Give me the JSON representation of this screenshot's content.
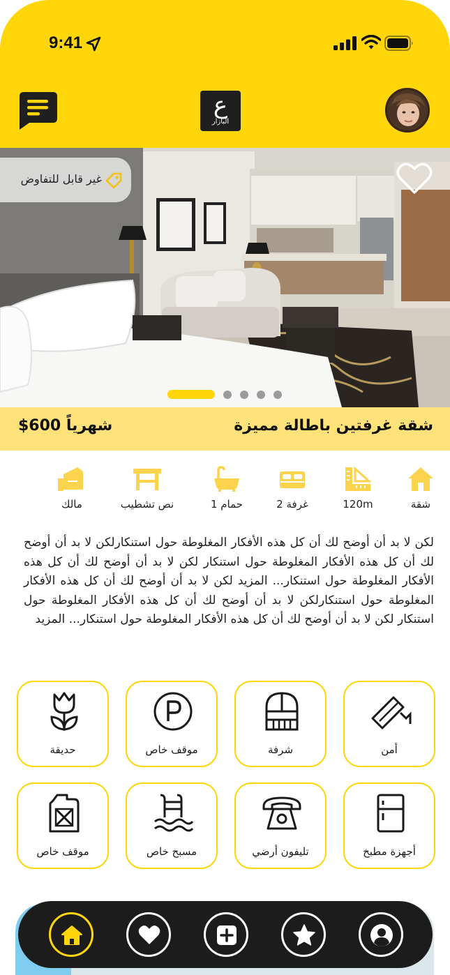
{
  "status_bar": {
    "time": "9:41"
  },
  "header": {
    "logo_glyph": "ع",
    "logo_text": "البازار",
    "chat_icon": "chat-icon",
    "avatar": "user-avatar"
  },
  "hero": {
    "badge_text": "غير قابل للتفاوض",
    "badge_icon": "tag-icon",
    "favorite_icon": "heart-outline-icon",
    "slide_count": 5,
    "active_slide": 1
  },
  "listing": {
    "title": "شقة غرفتين باطالة مميزة",
    "price": "$600 شهرياً"
  },
  "features": [
    {
      "icon": "house-icon",
      "label": "شقة"
    },
    {
      "icon": "ruler-icon",
      "label": "120m"
    },
    {
      "icon": "bed-icon",
      "label": "2 غرفة"
    },
    {
      "icon": "bathtub-icon",
      "label": "1 حمام"
    },
    {
      "icon": "table-icon",
      "label": "نص تشطيب"
    },
    {
      "icon": "owner-icon",
      "label": "مالك"
    }
  ],
  "description": "لكن لا بد أن أوضح لك أن كل هذه الأفكار المغلوطة حول استنكارلكن لا بد أن أوضح لك أن كل هذه الأفكار المغلوطة حول استنكار  لكن لا بد أن أوضح لك أن كل هذه الأفكار المغلوطة حول استنكار... المزيد   لكن لا بد أن أوضح لك أن كل هذه الأفكار المغلوطة حول استنكارلكن لا بد أن أوضح لك أن كل هذه الأفكار المغلوطة حول استنكار  لكن لا بد أن أوضح لك أن كل هذه الأفكار المغلوطة حول استنكار... المزيد",
  "amenities": [
    {
      "icon": "security-camera-icon",
      "label": "أمن"
    },
    {
      "icon": "balcony-icon",
      "label": "شرفة"
    },
    {
      "icon": "parking-icon",
      "label": "موقف خاص"
    },
    {
      "icon": "tulip-icon",
      "label": "حديقة"
    },
    {
      "icon": "fridge-icon",
      "label": "أجهزة مطبخ"
    },
    {
      "icon": "telephone-icon",
      "label": "تليفون أرضي"
    },
    {
      "icon": "pool-icon",
      "label": "مسبح خاص"
    },
    {
      "icon": "fuel-can-icon",
      "label": "موقف خاص"
    }
  ],
  "bottom_nav": [
    {
      "icon": "home-icon",
      "active": true
    },
    {
      "icon": "heart-icon",
      "active": false
    },
    {
      "icon": "add-icon",
      "active": false
    },
    {
      "icon": "star-icon",
      "active": false
    },
    {
      "icon": "profile-icon",
      "active": false
    }
  ],
  "colors": {
    "brand_yellow": "#FFD60A",
    "title_bar": "#FFE27A",
    "feature_icon": "#FCD34D",
    "dark": "#1c1c1c"
  }
}
